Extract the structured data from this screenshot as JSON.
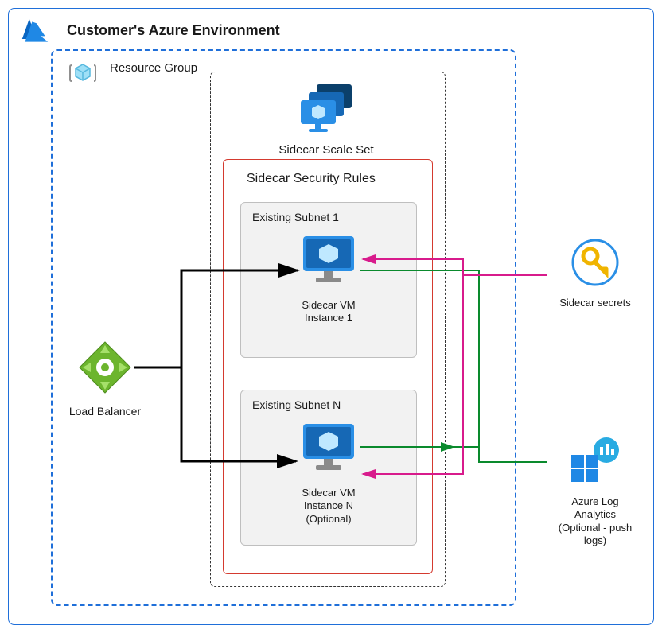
{
  "diagram": {
    "environment_title": "Customer's Azure Environment",
    "resource_group_label": "Resource Group",
    "scale_set_label": "Sidecar Scale Set",
    "security_rules_label": "Sidecar Security Rules",
    "subnet1": {
      "title": "Existing Subnet 1",
      "vm_label_line1": "Sidecar VM",
      "vm_label_line2": "Instance 1"
    },
    "subnetN": {
      "title": "Existing Subnet N",
      "vm_label_line1": "Sidecar VM",
      "vm_label_line2": "Instance N",
      "vm_label_line3": "(Optional)"
    },
    "load_balancer_label": "Load Balancer",
    "secrets_label": "Sidecar secrets",
    "log_analytics_line1": "Azure Log",
    "log_analytics_line2": "Analytics",
    "log_analytics_line3": "(Optional - push",
    "log_analytics_line4": "logs)"
  }
}
